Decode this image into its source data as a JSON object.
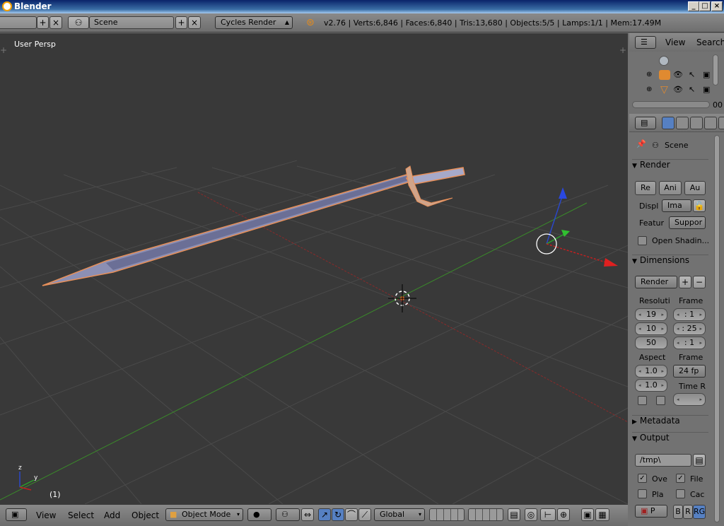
{
  "window": {
    "title": "Blender"
  },
  "info_header": {
    "scene_label": "Scene",
    "render_engine": "Cycles Render",
    "stats": "v2.76 | Verts:6,846 | Faces:6,840 | Tris:13,680 | Objects:5/5 | Lamps:1/1 | Mem:17.49M"
  },
  "viewport": {
    "view_label": "User Persp",
    "frame_label": "(1)"
  },
  "header_3d": {
    "menus": [
      "View",
      "Select",
      "Add",
      "Object"
    ],
    "mode": "Object Mode",
    "orientation": "Global"
  },
  "outliner": {
    "menus": [
      "View",
      "Search"
    ],
    "scroll_value": "00"
  },
  "properties": {
    "context": "Scene",
    "render": {
      "title": "Render",
      "buttons": [
        "Re",
        "Ani",
        "Au"
      ],
      "display_label": "Displ",
      "display_value": "Ima",
      "feature_label": "Featur",
      "feature_value": "Suppor",
      "open_shading": "Open Shadin..."
    },
    "dimensions": {
      "title": "Dimensions",
      "preset": "Render",
      "resolution_label": "Resoluti",
      "frame_label": "Frame",
      "res_x": "19",
      "res_y": "10",
      "res_pct": "50",
      "frame_start": ": 1",
      "frame_end": ": 25",
      "frame_step": ": 1",
      "aspect_label": "Aspect",
      "aspect_x": "1.0",
      "aspect_y": "1.0",
      "fps_label": "Frame",
      "fps": "24 fp",
      "time_label": "Time R"
    },
    "metadata": {
      "title": "Metadata"
    },
    "output": {
      "title": "Output",
      "path": "/tmp\\",
      "overwrite": "Ove",
      "file_ext": "File",
      "placeholders": "Pla",
      "cache": "Cac",
      "format": "P",
      "color_b": "B",
      "color_r": "R",
      "color_rg": "RG"
    }
  },
  "colors": {
    "viewport_bg": "#393939",
    "panel_bg": "#727272",
    "selection_orange": "#f08a3c",
    "x_axis": "#c02020",
    "y_axis": "#3c9a2c",
    "z_axis": "#2050d0"
  }
}
